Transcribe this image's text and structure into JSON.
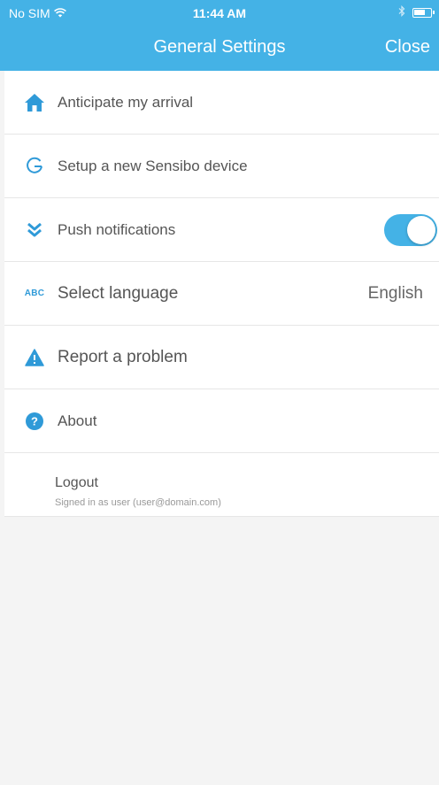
{
  "status": {
    "carrier": "No SIM",
    "time": "11:44 AM"
  },
  "nav": {
    "title": "General Settings",
    "close": "Close"
  },
  "rows": [
    {
      "label": "Anticipate my arrival",
      "icon": "home-icon"
    },
    {
      "label": "Setup a new Sensibo device",
      "icon": "setup-icon"
    },
    {
      "label": "Push notifications",
      "icon": "chevrons-down-icon",
      "toggle_on": true
    },
    {
      "label": "Select language",
      "icon": "abc-icon",
      "icon_text": "ABC",
      "value": "English"
    },
    {
      "label": "Report a problem",
      "icon": "warning-icon"
    },
    {
      "label": "About",
      "icon": "help-icon",
      "icon_text": "?"
    }
  ],
  "logout": {
    "title": "Logout",
    "subtitle": "Signed in as user (user@domain.com)"
  },
  "colors": {
    "accent": "#44b2e6",
    "icon": "#2f9ad8"
  }
}
